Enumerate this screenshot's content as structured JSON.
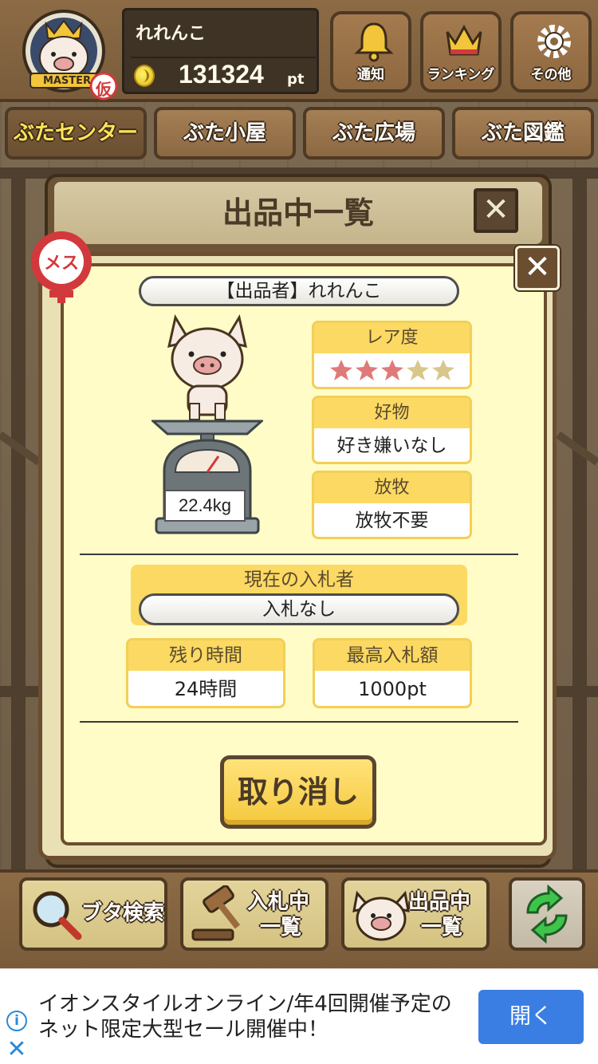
{
  "header": {
    "username": "れれんこ",
    "points": "131324",
    "points_unit": "pt",
    "rank_badge": "MASTER",
    "provisional_mark": "仮",
    "buttons": {
      "notice": "通知",
      "ranking": "ランキング",
      "other": "その他"
    }
  },
  "tabs": [
    {
      "label": "ぶたセンター",
      "active": true
    },
    {
      "label": "ぶた小屋",
      "active": false
    },
    {
      "label": "ぶた広場",
      "active": false
    },
    {
      "label": "ぶた図鑑",
      "active": false
    }
  ],
  "back_panel": {
    "title": "出品中一覧",
    "close": "✕"
  },
  "dialog": {
    "gender": "メス",
    "close": "✕",
    "seller": "【出品者】れれんこ",
    "weight": "22.4kg",
    "rarity": {
      "label": "レア度",
      "filled": 3,
      "total": 5
    },
    "favorite": {
      "label": "好物",
      "value": "好き嫌いなし"
    },
    "grazing": {
      "label": "放牧",
      "value": "放牧不要"
    },
    "bidder": {
      "label": "現在の入札者",
      "value": "入札なし"
    },
    "remaining": {
      "label": "残り時間",
      "value": "24時間"
    },
    "highest_bid": {
      "label": "最高入札額",
      "value": "1000pt"
    },
    "cancel_label": "取り消し"
  },
  "toolbar": {
    "search": "ブタ検索",
    "bidding_line1": "入札中",
    "bidding_line2": "一覧",
    "listing_line1": "出品中",
    "listing_line2": "一覧"
  },
  "ad": {
    "text": "イオンスタイルオンライン/年4回開催予定のネット限定大型セール開催中！",
    "button": "開く",
    "info_icon": "i",
    "close_icon": "✕"
  },
  "colors": {
    "wood": "#8c6b45",
    "panel_cream": "#fffcc7",
    "card_header": "#fbd963",
    "star_filled": "#e07a7a",
    "star_empty": "#d8c78a",
    "ad_button": "#3b7ee3"
  }
}
